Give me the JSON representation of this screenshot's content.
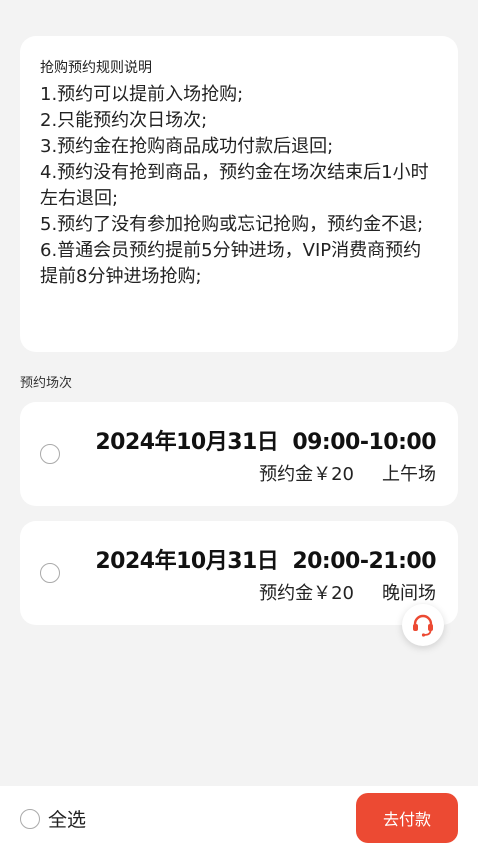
{
  "rules": {
    "title": "抢购预约规则说明",
    "items": [
      "1.预约可以提前入场抢购;",
      "2.只能预约次日场次;",
      "3.预约金在抢购商品成功付款后退回;",
      "4.预约没有抢到商品，预约金在场次结束后1小时左右退回;",
      "5.预约了没有参加抢购或忘记抢购，预约金不退;",
      "6.普通会员预约提前5分钟进场，VIP消费商预约提前8分钟进场抢购;"
    ]
  },
  "section_label": "预约场次",
  "sessions": [
    {
      "date": "2024年10月31日",
      "time": "09:00-10:00",
      "deposit": "预约金￥20",
      "period": "上午场",
      "selected": false
    },
    {
      "date": "2024年10月31日",
      "time": "20:00-21:00",
      "deposit": "预约金￥20",
      "period": "晚间场",
      "selected": false
    }
  ],
  "support_icon": "customer-service-headset-icon",
  "footer": {
    "select_all_label": "全选",
    "pay_label": "去付款"
  },
  "colors": {
    "accent": "#ec4a33",
    "background": "#f3f3f3",
    "card": "#ffffff"
  }
}
